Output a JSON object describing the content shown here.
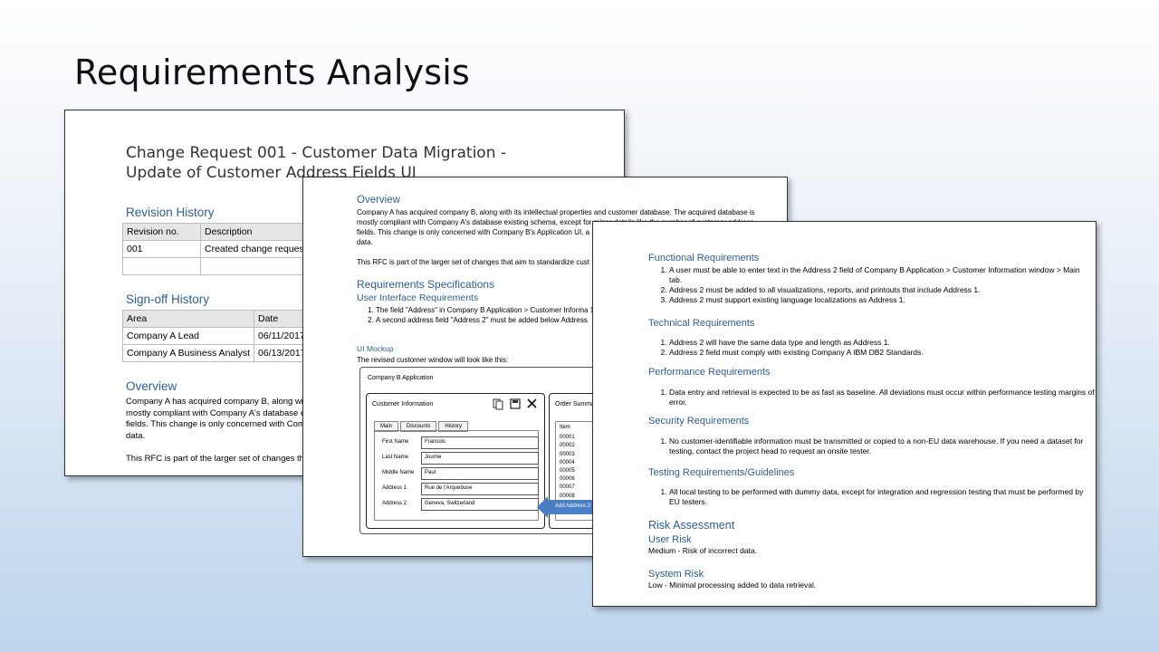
{
  "slide_title": "Requirements Analysis",
  "page1": {
    "doc_title": "Change Request 001 - Customer Data Migration - Update of Customer Address Fields UI",
    "revision_heading": "Revision History",
    "revision_headers": [
      "Revision no.",
      "Description"
    ],
    "revision_rows": [
      [
        "001",
        "Created change request"
      ],
      [
        "",
        ""
      ]
    ],
    "signoff_heading": "Sign-off History",
    "signoff_headers": [
      "Area",
      "Date"
    ],
    "signoff_rows": [
      [
        "Company A Lead",
        "06/11/2017"
      ],
      [
        "Company A Business Analyst",
        "06/13/2017"
      ]
    ],
    "overview_heading": "Overview",
    "overview_lines": [
      "Company A has acquired company B, along wit",
      "mostly compliant with Company A's database e",
      "fields. This change is only concerned with Com",
      "data."
    ],
    "rfc_line": "This RFC is part of the larger set of changes tha"
  },
  "page2": {
    "overview_heading": "Overview",
    "overview_lines": [
      "Company A has acquired company B, along with its intellectual properties and customer database. The acquired database is",
      "mostly compliant with Company A's database existing schema, except for minor details like the number of customer address",
      "fields. This change is only concerned with Company B's Application UI, a",
      "data."
    ],
    "rfc_line": "This RFC is part of the larger set of changes that aim to standardize cust",
    "req_spec_heading": "Requirements Specifications",
    "ui_req_heading": "User Interface Requirements",
    "ui_req_items": [
      "The field \"Address\" in Company B Application > Customer Informa 1\".",
      "A second address field \"Address 2\" must be added below Address"
    ],
    "mockup_heading": "UI Mockup",
    "mockup_caption": "The revised customer window will look like this:",
    "mockup": {
      "app_title": "Company B Application",
      "customer_title": "Customer Information",
      "tabs": [
        "Main",
        "Discounts",
        "History"
      ],
      "fields": [
        {
          "label": "First Name",
          "value": "Francois"
        },
        {
          "label": "Last Name",
          "value": "Journe"
        },
        {
          "label": "Middle Name",
          "value": "Paul"
        },
        {
          "label": "Address 1",
          "value": "Rue de l'Arquebuse"
        },
        {
          "label": "Address 2",
          "value": "Geneva, Switzerland"
        }
      ],
      "order_title": "Order Summar",
      "order_col": "Item",
      "order_items": [
        "00001",
        "00002",
        "00003",
        "00004",
        "00005",
        "00006",
        "00007",
        "00008"
      ],
      "arrow_label": "Add Address 2 f"
    }
  },
  "page3": {
    "functional_heading": "Functional Requirements",
    "functional_items": [
      "A user must be able to enter text in the Address 2 field of Company B Application > Customer Information window > Main tab.",
      "Address 2 must be added to all visualizations, reports, and printouts that include Address 1.",
      "Address 2 must support existing language localizations as Address 1."
    ],
    "technical_heading": "Technical Requirements",
    "technical_items": [
      "Address 2 will have the same data type and length as Address 1.",
      "Address 2 field must comply with existing Company A IBM DB2 Standards."
    ],
    "performance_heading": "Performance Requirements",
    "performance_items": [
      "Data entry and retrieval is expected to be as fast as baseline. All deviations must occur within performance testing margins of error."
    ],
    "security_heading": "Security Requirements",
    "security_items": [
      "No customer-identifiable information must be transmitted or copied to a non-EU data warehouse. If you need a dataset for testing, contact the project head to request an onsite tester."
    ],
    "testing_heading": "Testing Requirements/Guidelines",
    "testing_items": [
      "All local testing to be performed with dummy data, except for integration and regression testing that must be performed by EU testers."
    ],
    "risk_heading": "Risk Assessment",
    "user_risk_heading": "User Risk",
    "user_risk_text": "Medium - Risk of incorrect data.",
    "system_risk_heading": "System Risk",
    "system_risk_text": "Low - Minimal processing added to data retrieval."
  }
}
